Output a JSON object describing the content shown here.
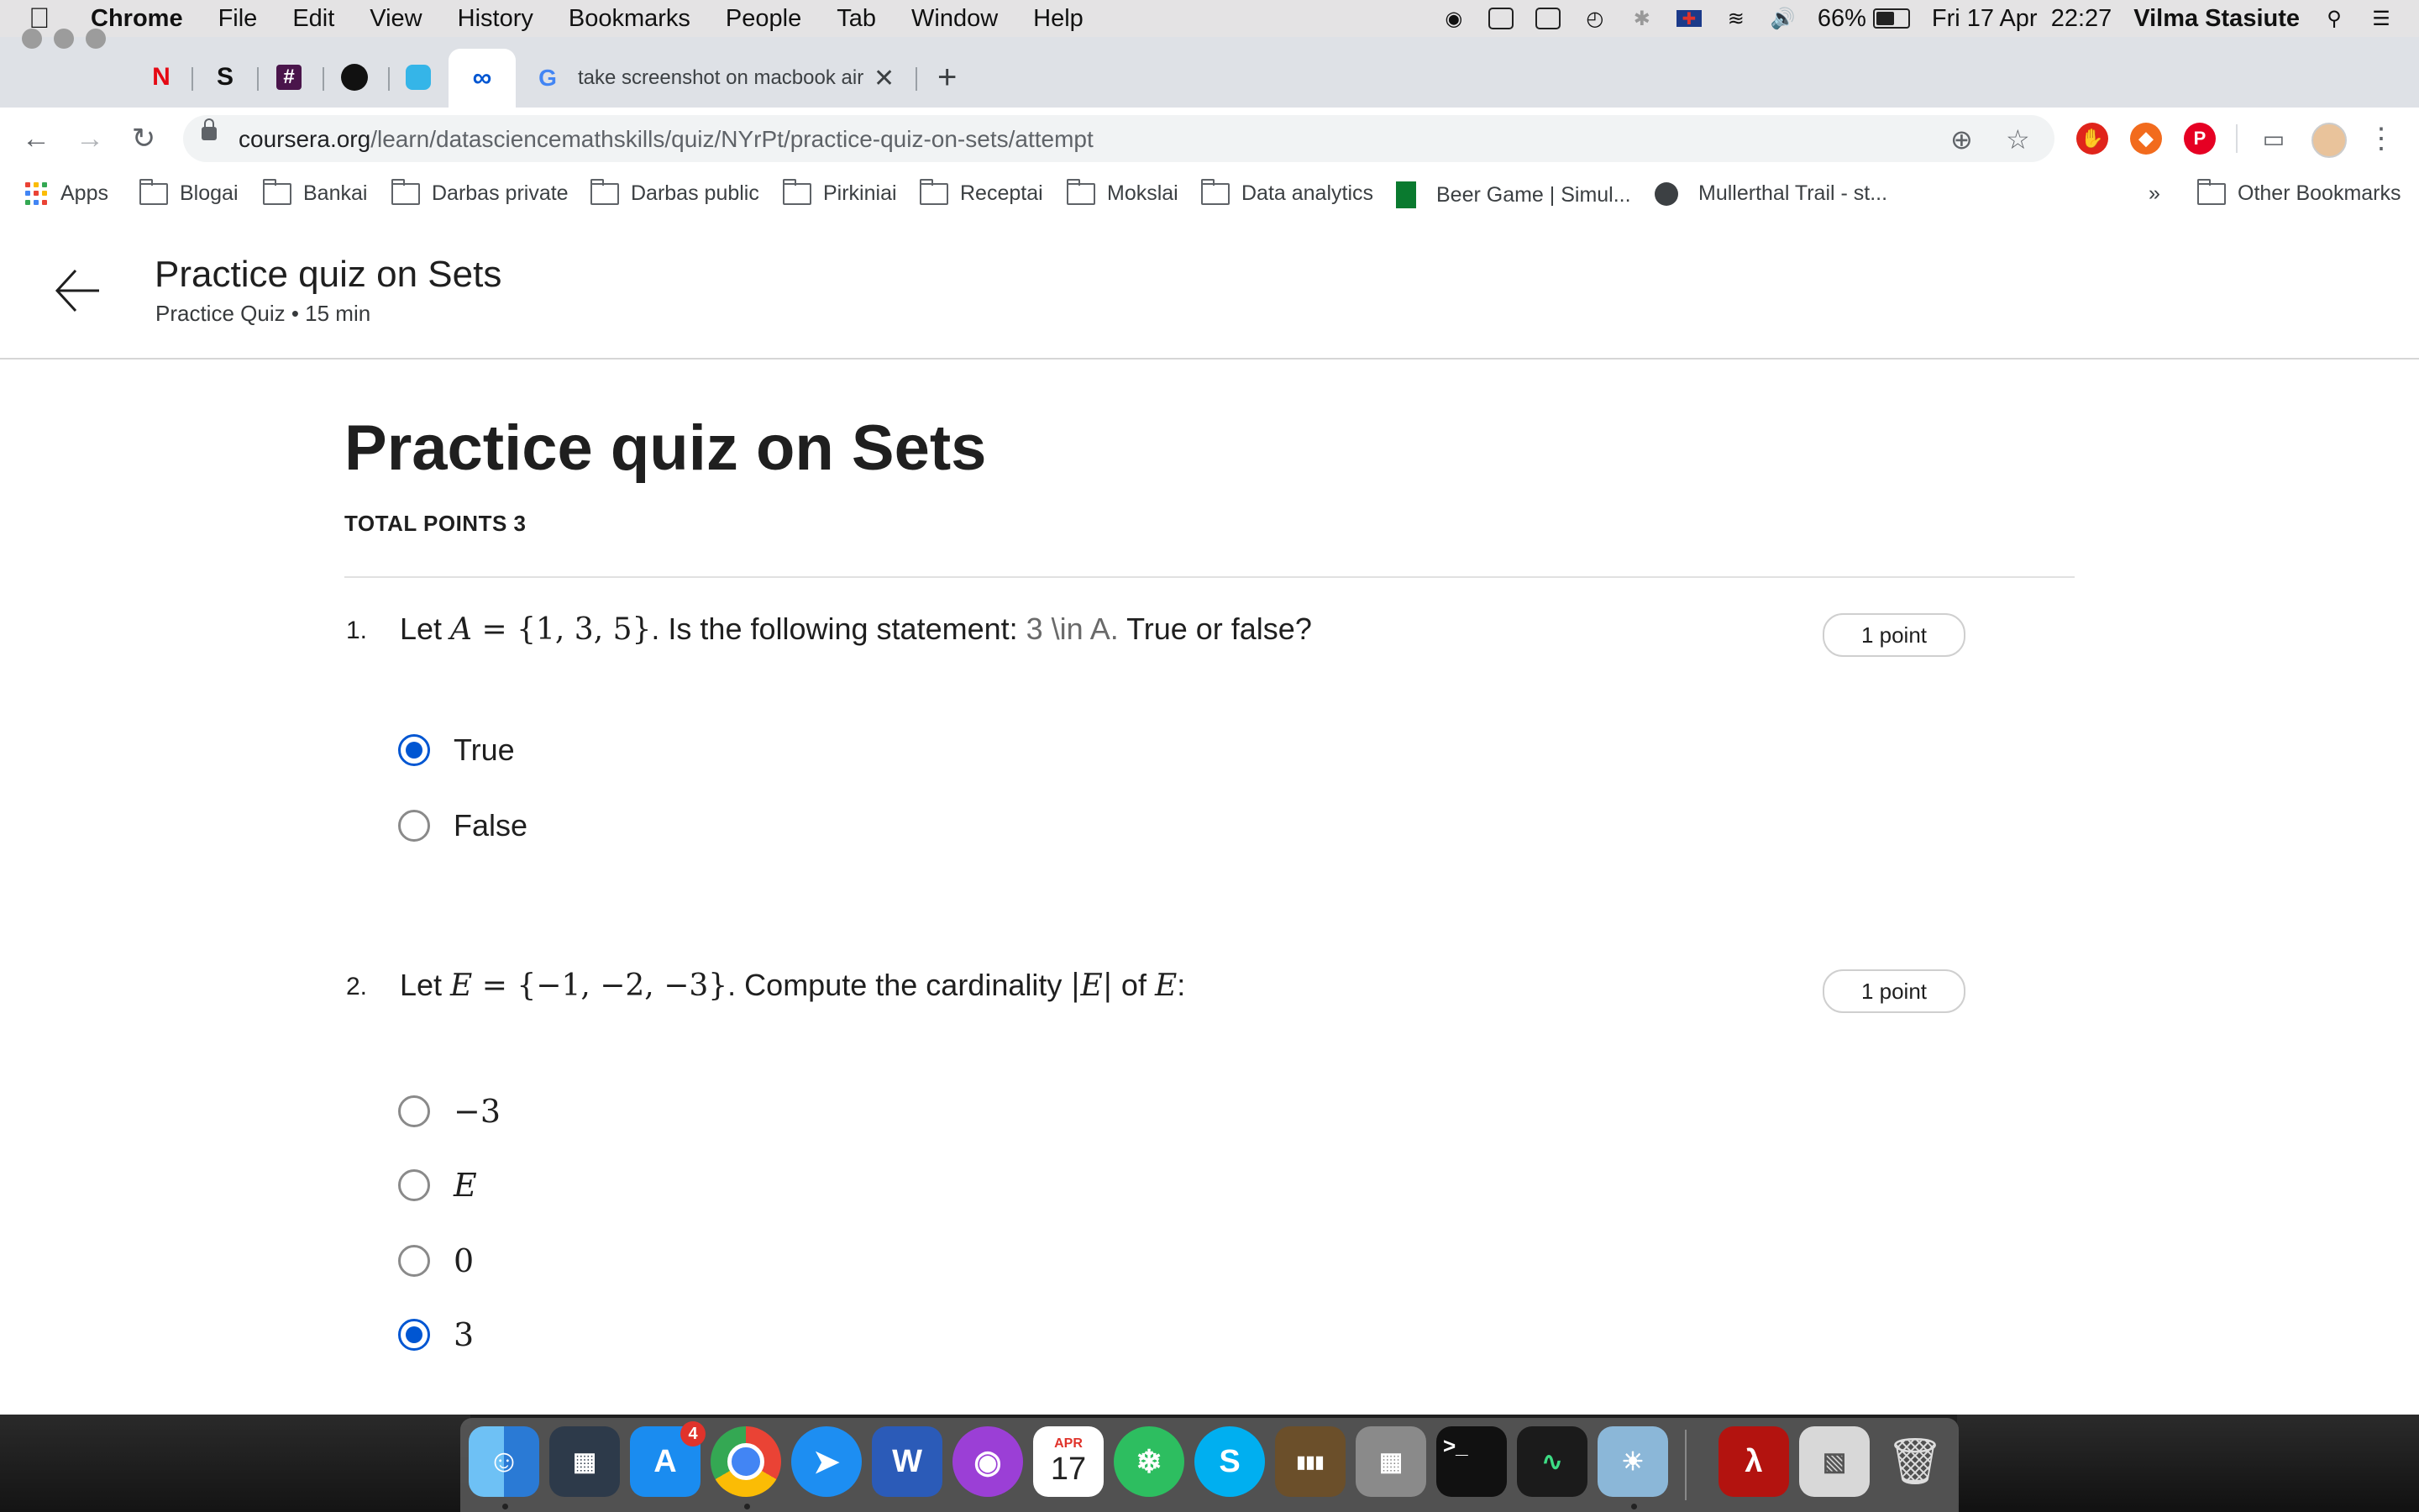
{
  "menubar": {
    "app_name": "Chrome",
    "items": [
      "File",
      "Edit",
      "View",
      "History",
      "Bookmarks",
      "People",
      "Tab",
      "Window",
      "Help"
    ],
    "battery_percent": "66%",
    "battery_level": 0.66,
    "datetime": "Fri 17 Apr  22:27",
    "user": "Vilma Stasiute"
  },
  "browser": {
    "pinned_tabs": [
      "N",
      "S"
    ],
    "active_tab_title": "take screenshot on macbook air",
    "url_host": "coursera.org",
    "url_path": "/learn/datasciencemathskills/quiz/NYrPt/practice-quiz-on-sets/attempt"
  },
  "bookmarks": {
    "apps": "Apps",
    "items": [
      "Blogai",
      "Bankai",
      "Darbas private",
      "Darbas public",
      "Pirkiniai",
      "Receptai",
      "Mokslai",
      "Data analytics",
      "Beer Game | Simul...",
      "Mullerthal Trail - st..."
    ],
    "overflow": "»",
    "other": "Other Bookmarks"
  },
  "header": {
    "title": "Practice quiz on Sets",
    "subtitle": "Practice Quiz • 15 min"
  },
  "quiz": {
    "title": "Practice quiz on Sets",
    "total_points": "TOTAL POINTS 3",
    "questions": [
      {
        "number": "1.",
        "text_before": "Let ",
        "math_a": "A",
        "math_a_rest": " = {1, 3, 5}",
        "text_mid": ". Is the following statement: ",
        "raw_tex": "3 \\in A.",
        "text_after": " True or false?",
        "points": "1 point",
        "options": [
          {
            "label": "True",
            "checked": true
          },
          {
            "label": "False",
            "checked": false
          }
        ]
      },
      {
        "number": "2.",
        "text_before": "Let ",
        "math_e": "E",
        "math_e_rest": " = {−1, −2, −3}",
        "text_mid": ". Compute the cardinality ",
        "math_card": "|E|",
        "text_of": " of ",
        "math_e2": "E",
        "text_after": ":",
        "points": "1 point",
        "options": [
          {
            "label": "−3",
            "checked": false
          },
          {
            "label": "E",
            "checked": false
          },
          {
            "label": "0",
            "checked": false
          },
          {
            "label": "3",
            "checked": true
          }
        ]
      }
    ]
  },
  "dock": {
    "badge_app_store": "4",
    "calendar_month": "APR",
    "calendar_day": "17"
  }
}
